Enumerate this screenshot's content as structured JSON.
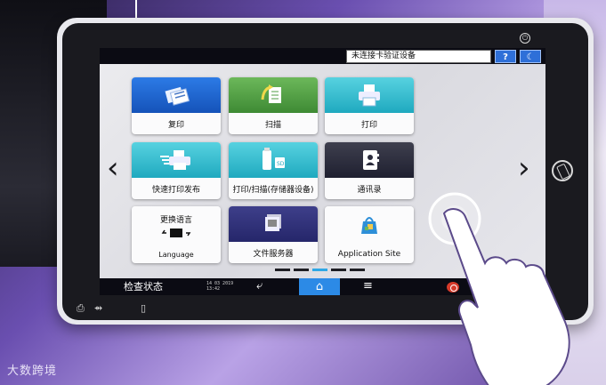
{
  "topbar": {
    "auth_status": "未连接卡验证设备",
    "help_label": "?",
    "night_label": "☾"
  },
  "tiles": [
    {
      "label": "复印",
      "icon": "copy-icon"
    },
    {
      "label": "扫描",
      "icon": "scan-icon"
    },
    {
      "label": "打印",
      "icon": "print-icon"
    },
    {
      "label": "快速打印发布",
      "icon": "quick-print-icon"
    },
    {
      "label": "打印/扫描(存储器设备)",
      "icon": "usb-storage-icon"
    },
    {
      "label": "通讯录",
      "icon": "address-book-icon"
    },
    {
      "label": "Language",
      "title": "更换语言",
      "icon": "language-switch-icon"
    },
    {
      "label": "文件服务器",
      "icon": "document-server-icon"
    },
    {
      "label": "Application Site",
      "icon": "application-site-icon"
    }
  ],
  "navigation": {
    "prev": "‹",
    "next": "›"
  },
  "bottombar": {
    "status_label": "检查状态",
    "date": "14 03 2019",
    "time": "13:42",
    "back_icon": "⤶",
    "home_icon": "⌂",
    "menu_icon": "≡"
  },
  "pagination": {
    "count": 5,
    "active": 3
  },
  "watermark": "大数跨境",
  "colors": {
    "accent_blue": "#2c8ae6",
    "stop_red": "#d63a2a",
    "tile_blue": "#1e66d0",
    "tile_green": "#4f9d44",
    "tile_cyan": "#34bfd3",
    "tile_dark": "#2b2c3c",
    "tile_navy": "#2f307a"
  }
}
